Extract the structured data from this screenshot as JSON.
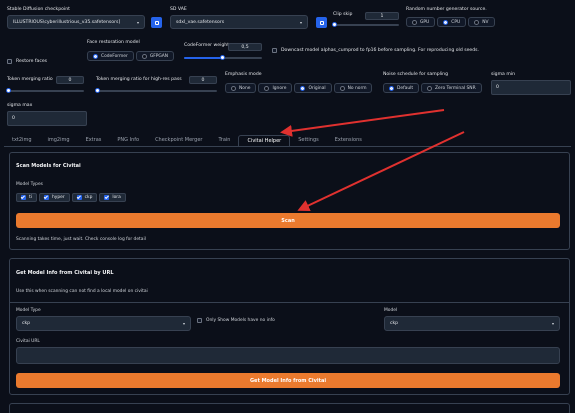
{
  "top": {
    "sd_checkpoint": {
      "label": "Stable Diffusion checkpoint",
      "value": "ILLUSTRIOUS\\cyberillustrious_v35.safetensors]"
    },
    "sd_vae": {
      "label": "SD VAE",
      "value": "sdxl_vae.safetensors"
    },
    "clip_skip": {
      "label": "Clip skip",
      "value": "1",
      "level": 0.0
    },
    "rng_source": {
      "label": "Random number generator source.",
      "options": [
        "GPU",
        "CPU",
        "NV"
      ],
      "selected": "CPU"
    },
    "face_restoration_model": {
      "label": "Face restoration model",
      "options": [
        "CodeFormer",
        "GFPGAN"
      ],
      "selected": "CodeFormer"
    },
    "codeformer_weight": {
      "label": "CodeFormer weight",
      "value": "0,5",
      "level": 0.5
    },
    "restore_faces": {
      "label": "Restore faces"
    },
    "downcast": {
      "label": "Downcast model alphas_cumprod to fp16 before sampling. For reproducing old seeds."
    },
    "token_merging": {
      "label": "Token merging ratio",
      "value": "0"
    },
    "token_merging_hr": {
      "label": "Token merging ratio for high-res pass",
      "value": "0"
    },
    "emphasis_mode": {
      "label": "Emphasis mode",
      "options": [
        "None",
        "Ignore",
        "Original",
        "No norm"
      ],
      "selected": "Original"
    },
    "noise_schedule": {
      "label": "Noise schedule for sampling",
      "options": [
        "Default",
        "Zero Terminal SNR"
      ],
      "selected": "Default"
    },
    "sigma_min": {
      "label": "sigma min",
      "value": "0"
    },
    "sigma_max": {
      "label": "sigma max",
      "value": "0"
    }
  },
  "tabs": [
    "txt2img",
    "img2img",
    "Extras",
    "PNG Info",
    "Checkpoint Merger",
    "Train",
    "Civitai Helper",
    "Settings",
    "Extensions"
  ],
  "active_tab": "Civitai Helper",
  "scan": {
    "title": "Scan Models for Civitai",
    "model_types_label": "Model Types",
    "model_types": [
      "ti",
      "hyper",
      "ckp",
      "lora"
    ],
    "button": "Scan",
    "note": "Scanning takes time, just wait. Check console log for detail"
  },
  "get_info": {
    "title": "Get Model Info from Civitai by URL",
    "desc": "Use this when scanning can not find a local model on civitai",
    "model_type_label": "Model Type",
    "model_type_value": "ckp",
    "only_show_label": "Only Show Models have no info",
    "model_label": "Model",
    "model_value": "ckp",
    "url_label": "Civitai URL",
    "url_value": "",
    "button": "Get Model Info from Civitai"
  },
  "colors": {
    "accent": "#2563eb",
    "orange": "#ea7a2e",
    "arrow": "#e0312f"
  }
}
